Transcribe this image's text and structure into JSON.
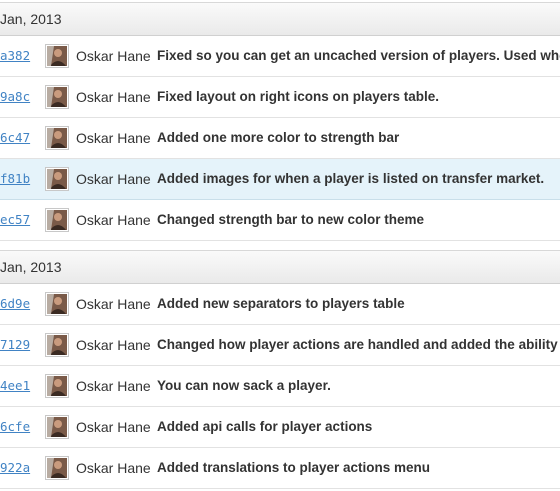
{
  "groups": [
    {
      "date": "Jan, 2013",
      "commits": [
        {
          "sha": "a382",
          "author": "Oskar Hane",
          "message": "Fixed so you can get an uncached version of players. Used when"
        },
        {
          "sha": "9a8c",
          "author": "Oskar Hane",
          "message": "Fixed layout on right icons on players table."
        },
        {
          "sha": "6c47",
          "author": "Oskar Hane",
          "message": "Added one more color to strength bar"
        },
        {
          "sha": "f81b",
          "author": "Oskar Hane",
          "message": "Added images for when a player is listed on transfer market."
        },
        {
          "sha": "ec57",
          "author": "Oskar Hane",
          "message": "Changed strength bar to new color theme"
        }
      ]
    },
    {
      "date": "Jan, 2013",
      "commits": [
        {
          "sha": "6d9e",
          "author": "Oskar Hane",
          "message": "Added new separators to players table"
        },
        {
          "sha": "7129",
          "author": "Oskar Hane",
          "message": "Changed how player actions are handled and added the ability to"
        },
        {
          "sha": "4ee1",
          "author": "Oskar Hane",
          "message": "You can now sack a player."
        },
        {
          "sha": "6cfe",
          "author": "Oskar Hane",
          "message": "Added api calls for player actions"
        },
        {
          "sha": "922a",
          "author": "Oskar Hane",
          "message": "Added translations to player actions menu"
        }
      ]
    }
  ],
  "colors": {
    "link": "#4183c4",
    "highlight_row": "#e5f3fa"
  },
  "avatar_icon": "user-avatar-icon"
}
